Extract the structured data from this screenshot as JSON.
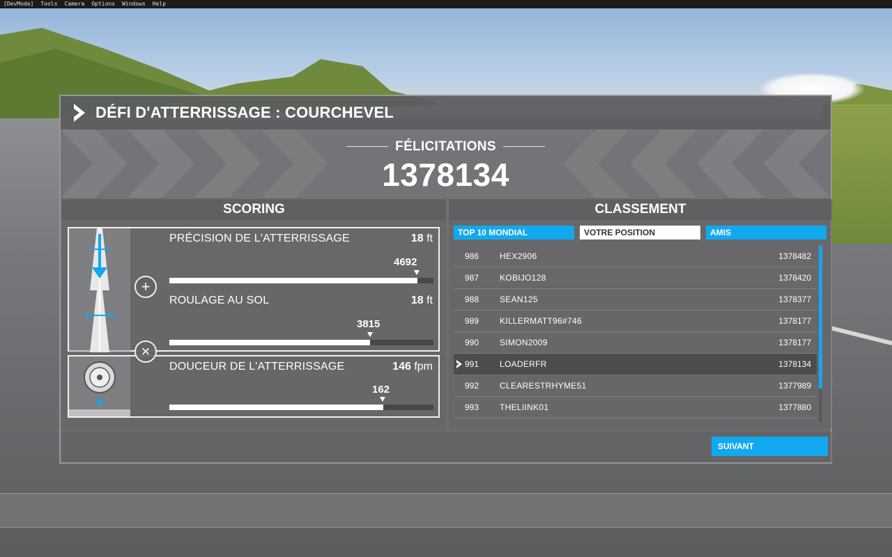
{
  "menubar": {
    "items": [
      "[DevMode]",
      "Tools",
      "Camera",
      "Options",
      "Windows",
      "Help"
    ]
  },
  "panel": {
    "title": "DÉFI D'ATTERRISSAGE : COURCHEVEL"
  },
  "banner": {
    "congrats_label": "FÉLICITATIONS",
    "total_score": "1378134"
  },
  "scoring": {
    "title": "SCORING",
    "metrics": [
      {
        "name": "PRÉCISION DE L'ATTERRISSAGE",
        "value": "18",
        "unit": "ft",
        "points": "4692",
        "progress": 0.94
      },
      {
        "name": "ROULAGE AU SOL",
        "value": "18",
        "unit": "ft",
        "points": "3815",
        "progress": 0.76
      },
      {
        "name": "DOUCEUR DE L'ATTERRISSAGE",
        "value": "146",
        "unit": "fpm",
        "points": "162",
        "progress": 0.81
      }
    ],
    "op_plus": "+",
    "op_times": "×"
  },
  "ranking": {
    "title": "CLASSEMENT",
    "tabs": [
      "TOP 10 MONDIAL",
      "VOTRE POSITION",
      "AMIS"
    ],
    "active_tab": "VOTRE POSITION",
    "rows": [
      {
        "rank": "986",
        "player": "HEX2906",
        "score": "1378482"
      },
      {
        "rank": "987",
        "player": "KOBIJO128",
        "score": "1378420"
      },
      {
        "rank": "988",
        "player": "SEAN125",
        "score": "1378377"
      },
      {
        "rank": "989",
        "player": "KILLERMATT96#746",
        "score": "1378177"
      },
      {
        "rank": "990",
        "player": "SIMON2009",
        "score": "1378177"
      },
      {
        "rank": "991",
        "player": "LOADERFR",
        "score": "1378134",
        "current": true
      },
      {
        "rank": "992",
        "player": "CLEARESTRHYME51",
        "score": "1377989"
      },
      {
        "rank": "993",
        "player": "THELIINK01",
        "score": "1377880"
      }
    ]
  },
  "footer": {
    "next_label": "SUIVANT"
  },
  "colors": {
    "accent": "#12a8ef",
    "text": "#ffffff",
    "panel": "#6e6e71"
  }
}
